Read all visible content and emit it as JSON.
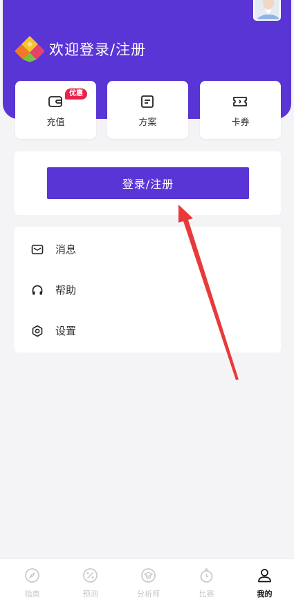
{
  "header": {
    "welcome_text": "欢迎登录/注册",
    "background_color": "#5a35d5"
  },
  "quick_actions": [
    {
      "label": "充值",
      "icon": "wallet-icon",
      "badge": "优惠"
    },
    {
      "label": "方案",
      "icon": "document-icon"
    },
    {
      "label": "卡券",
      "icon": "ticket-icon"
    }
  ],
  "login": {
    "button_label": "登录/注册"
  },
  "menu": [
    {
      "label": "消息",
      "icon": "mail-icon"
    },
    {
      "label": "帮助",
      "icon": "headphones-icon"
    },
    {
      "label": "设置",
      "icon": "gear-icon"
    }
  ],
  "tabbar": {
    "items": [
      {
        "label": "指南",
        "icon": "compass-icon"
      },
      {
        "label": "预测",
        "icon": "percent-icon"
      },
      {
        "label": "分析师",
        "icon": "graduation-icon"
      },
      {
        "label": "比赛",
        "icon": "stopwatch-icon"
      },
      {
        "label": "我的",
        "icon": "person-icon"
      }
    ],
    "active_index": 4
  },
  "annotation": {
    "arrow_color": "#e83a3a"
  }
}
